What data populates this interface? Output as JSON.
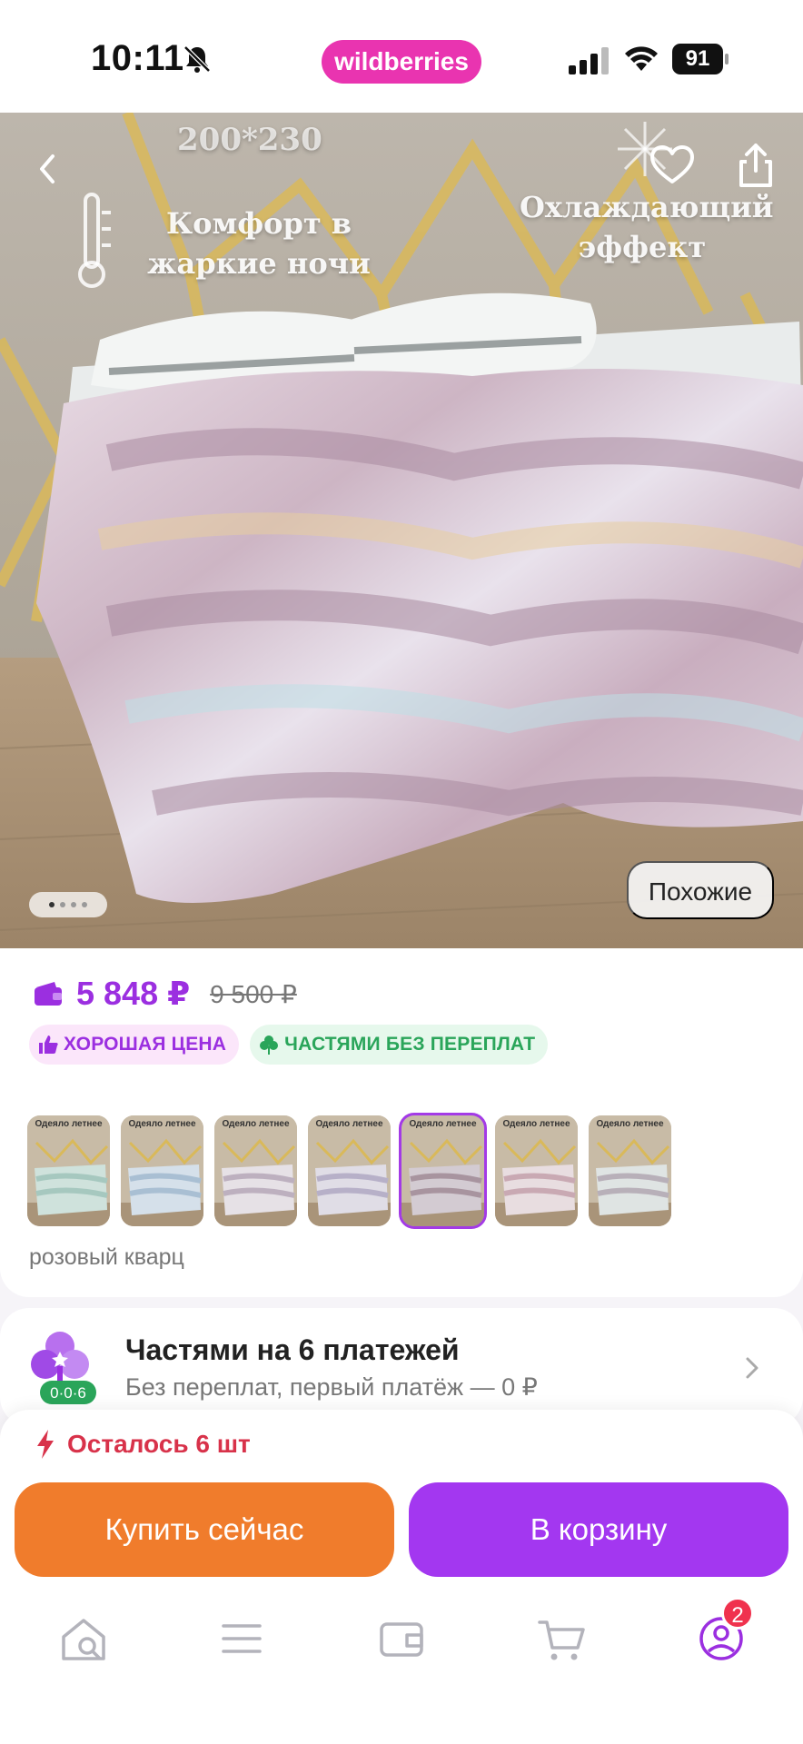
{
  "status_bar": {
    "time": "10:11",
    "app_pill": "wildberries",
    "battery": "91"
  },
  "hero": {
    "size_text": "200*230",
    "comfort_text": "Комфорт в жаркие ночи",
    "cooling_text": "Охлаждающий эффект",
    "similar_label": "Похожие",
    "slide_count": 4,
    "active_slide": 1
  },
  "product": {
    "price": "5 848 ₽",
    "old_price": "9 500 ₽",
    "badge_good_price": "ХОРОШАЯ ЦЕНА",
    "badge_installments": "ЧАСТЯМИ БЕЗ ПЕРЕПЛАТ",
    "thumb_caption": "Одеяло летнее",
    "thumb_count": 7,
    "selected_thumb": 5,
    "color_name": "розовый кварц"
  },
  "installments": {
    "title": "Частями на 6 платежей",
    "subtitle": "Без переплат, первый платёж — 0 ₽",
    "icon_label": "0·0·6"
  },
  "purchase": {
    "stock": "Осталось 6 шт",
    "buy_now": "Купить сейчас",
    "to_cart": "В корзину"
  },
  "tabbar": {
    "profile_badge": "2"
  },
  "colors": {
    "accent_purple": "#a337f0",
    "accent_orange": "#f07c2c",
    "price_purple": "#9b2fe0",
    "stock_red": "#d8324a",
    "badge_green": "#2aa55a"
  }
}
